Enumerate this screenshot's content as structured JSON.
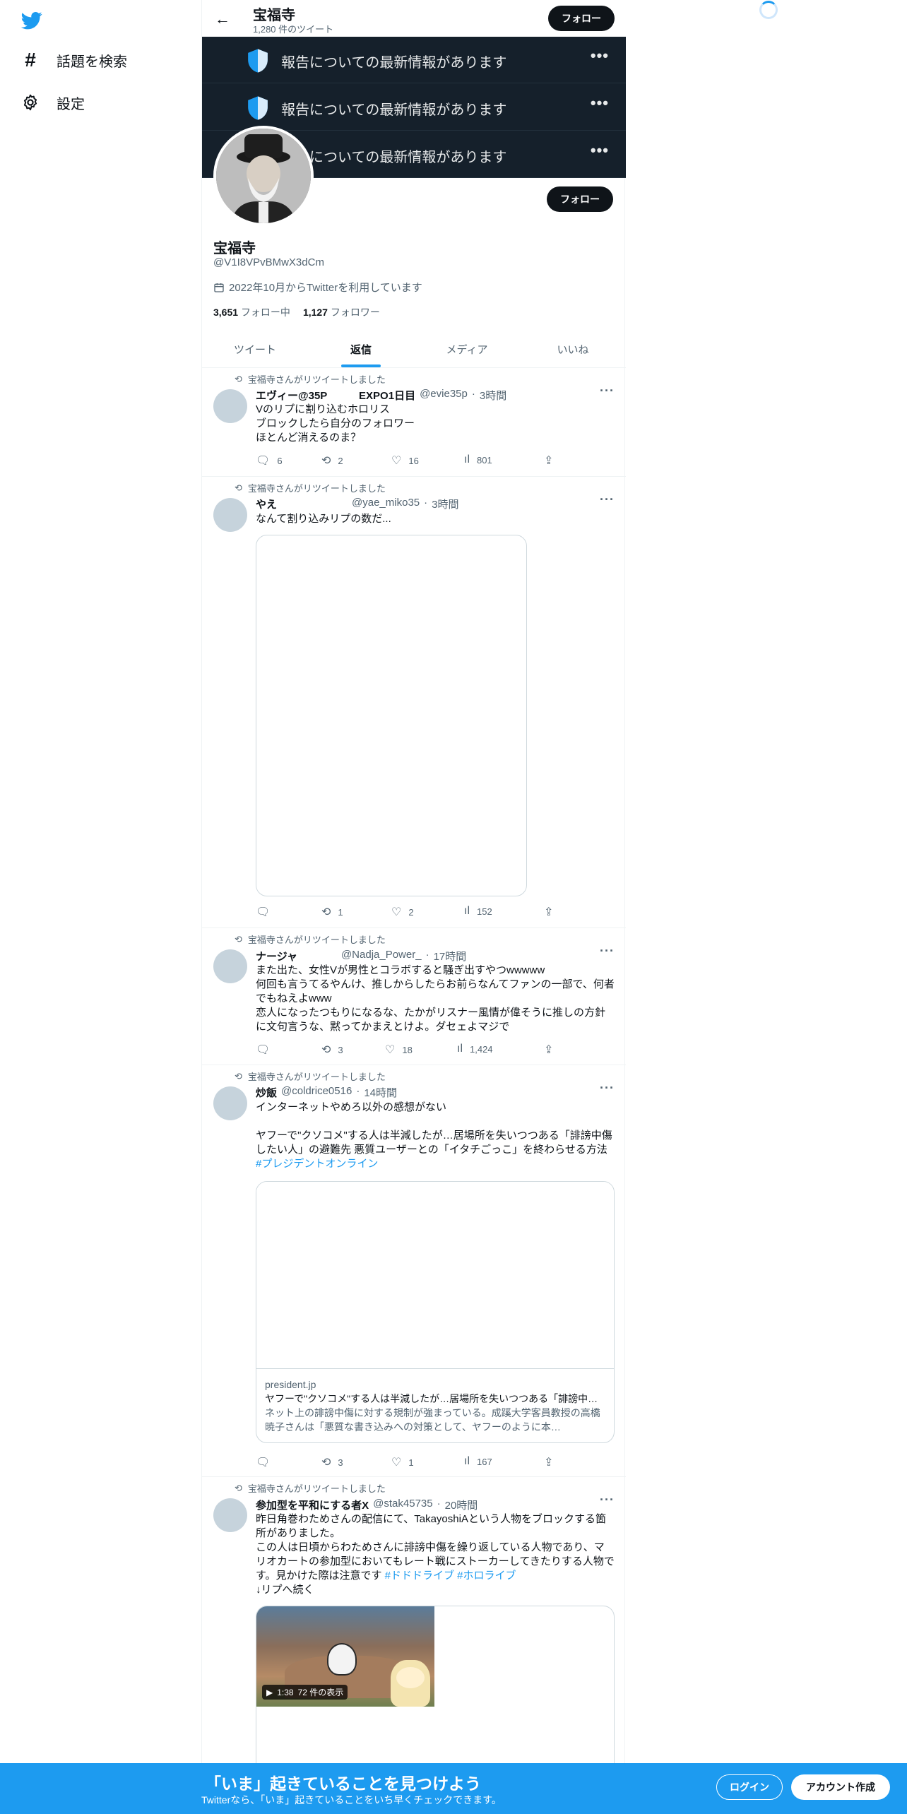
{
  "nav": {
    "explore_label": "話題を検索",
    "settings_label": "設定"
  },
  "header": {
    "name": "宝福寺",
    "tweet_count": "1,280 件のツイート",
    "follow_label": "フォロー"
  },
  "notices": [
    {
      "text": "報告についての最新情報があります"
    },
    {
      "text": "報告についての最新情報があります"
    },
    {
      "text": "報告についての最新情報があります"
    }
  ],
  "profile": {
    "name": "宝福寺",
    "handle": "@V1I8VPvBMwX3dCm",
    "joined": "2022年10月からTwitterを利用しています",
    "following_count": "3,651",
    "following_label": "フォロー中",
    "followers_count": "1,127",
    "followers_label": "フォロワー",
    "follow_label": "フォロー"
  },
  "tabs": [
    {
      "label": "ツイート"
    },
    {
      "label": "返信"
    },
    {
      "label": "メディア"
    },
    {
      "label": "いいね"
    }
  ],
  "retweet_label": "宝福寺さんがリツイートしました",
  "tweets": [
    {
      "name": "エヴィー@35P　　　EXPO1日目",
      "handle": "@evie35p",
      "time": "3時間",
      "body": "Vのリプに割り込むホロリス\nブロックしたら自分のフォロワー\nほとんど消えるのま？",
      "replies": "6",
      "retweets": "2",
      "likes": "16",
      "views": "801"
    },
    {
      "name": "やえ",
      "handle": "@yae_miko35",
      "time": "3時間",
      "body": "なんて割り込みリプの数だ...",
      "replies": "",
      "retweets": "1",
      "likes": "2",
      "views": "152"
    },
    {
      "name": "ナージャ",
      "handle": "@Nadja_Power_",
      "time": "17時間",
      "body": "また出た、女性Vが男性とコラボすると騒ぎ出すやつwwwww\n何回も言うてるやんけ、推しからしたらお前らなんてファンの一部で、何者でもねえよwww\n恋人になったつもりになるな、たかがリスナー風情が偉そうに推しの方針に文句言うな、黙ってかまえとけよ。ダセェよマジで",
      "replies": "",
      "retweets": "3",
      "likes": "18",
      "views": "1,424"
    },
    {
      "name": "炒飯",
      "handle": "@coldrice0516",
      "time": "14時間",
      "body_pre": "インターネットやめろ以外の感想がない\n\nヤフーで\"クソコメ\"する人は半減したが…居場所を失いつつある「誹謗中傷したい人」の避難先 悪質ユーザーとの「イタチごっこ」を終わらせる方法 ",
      "body_tag": "#プレジデントオンライン",
      "card_domain": "president.jp",
      "card_title": "ヤフーで\"クソコメ\"する人は半減したが…居場所を失いつつある「誹謗中傷したい人」の避難先",
      "card_desc": "ネット上の誹謗中傷に対する規制が強まっている。成蹊大学客員教授の高橋暁子さんは「悪質な書き込みへの対策として、ヤフーのように本…",
      "replies": "",
      "retweets": "3",
      "likes": "1",
      "views": "167"
    },
    {
      "name": "参加型を平和にする者X",
      "handle": "@stak45735",
      "time": "20時間",
      "body_pre": "昨日角巻わためさんの配信にて、TakayoshiAという人物をブロックする箇所がありました。\nこの人は日頃からわためさんに誹謗中傷を繰り返している人物であり、マリオカートの参加型においてもレート戦にストーカーしてきたりする人物です。見かけた際は注意です ",
      "body_tag": "#ドドドライブ #ホロライブ",
      "body_post": "\n↓リプへ続く",
      "video_duration": "1:38",
      "video_views": "72 件の表示"
    }
  ],
  "bottom": {
    "title": "「いま」起きていることを見つけよう",
    "subtitle": "Twitterなら、「いま」起きていることをいち早くチェックできます。",
    "login_label": "ログイン",
    "signup_label": "アカウント作成"
  },
  "colors": {
    "accent": "#1d9bf0",
    "banner_bg": "#15202b",
    "text": "#0f1419",
    "muted": "#536471"
  }
}
